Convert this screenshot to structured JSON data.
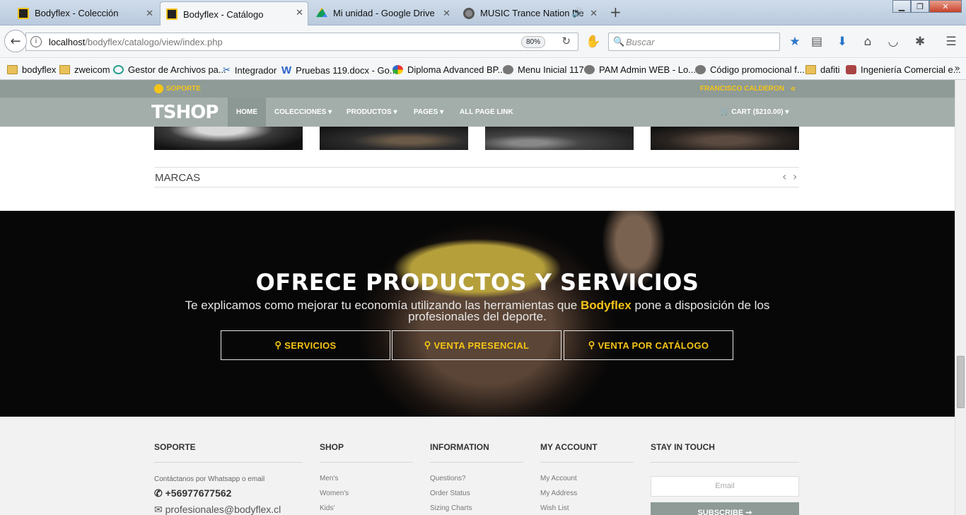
{
  "browser": {
    "tabs": [
      {
        "title": "Bodyflex - Colección",
        "icon": "bodyflex-favicon"
      },
      {
        "title": "Bodyflex - Catálogo",
        "icon": "bodyflex-favicon",
        "active": true
      },
      {
        "title": "Mi unidad - Google Drive",
        "icon": "google-drive-favicon"
      },
      {
        "title": "MUSIC Trance Nation Ne",
        "icon": "music-favicon"
      }
    ],
    "new_tab": "+",
    "url_host": "localhost",
    "url_path": "/bodyflex/catalogo/view/index.php",
    "zoom": "80%",
    "search_placeholder": "Buscar",
    "bookmarks": [
      {
        "label": "bodyflex",
        "icon": "folder"
      },
      {
        "label": "zweicom",
        "icon": "folder"
      },
      {
        "label": "Gestor de Archivos pa...",
        "icon": "circle"
      },
      {
        "label": "Integrador",
        "icon": "tool"
      },
      {
        "label": "Pruebas 119.docx - Go...",
        "icon": "w"
      },
      {
        "label": "Diploma Advanced BP...",
        "icon": "wheel"
      },
      {
        "label": "Menu Inicial 117",
        "icon": "globe"
      },
      {
        "label": "PAM Admin WEB - Lo...",
        "icon": "globe"
      },
      {
        "label": "Código promocional f...",
        "icon": "globe"
      },
      {
        "label": "dafiti",
        "icon": "folder"
      },
      {
        "label": "Ingeniería Comercial e...",
        "icon": "person"
      }
    ],
    "more": "»"
  },
  "site": {
    "topbar": {
      "support": "SOPORTE",
      "user": "FRANCISCO CALDERON",
      "toggle": "«"
    },
    "logo": "TSHOP",
    "nav": {
      "home": "HOME",
      "colecciones": "COLECCIONES",
      "productos": "PRODUCTOS",
      "pages": "PAGES",
      "all_page_link": "ALL PAGE LINK",
      "cart": "CART ($210.00)"
    },
    "marcas": {
      "title": "MARCAS",
      "prev": "‹",
      "next": "›"
    },
    "hero": {
      "title": "OFRECE PRODUCTOS Y SERVICIOS",
      "text_before": "Te explicamos como mejorar tu economía utilizando las herramientas que ",
      "brand": "Bodyflex",
      "text_after": " pone a disposición de los profesionales del deporte.",
      "buttons": [
        "SERVICIOS",
        "VENTA PRESENCIAL",
        "VENTA POR CATÁLOGO"
      ]
    },
    "footer": {
      "soporte": {
        "title": "SOPORTE",
        "note": "Contáctanos por Whatsapp o email",
        "phone": "+56977677562",
        "email": "profesionales@bodyflex.cl"
      },
      "shop": {
        "title": "SHOP",
        "items": [
          "Men's",
          "Women's",
          "Kids'"
        ]
      },
      "information": {
        "title": "INFORMATION",
        "items": [
          "Questions?",
          "Order Status",
          "Sizing Charts"
        ]
      },
      "account": {
        "title": "MY ACCOUNT",
        "items": [
          "My Account",
          "My Address",
          "Wish List"
        ]
      },
      "touch": {
        "title": "STAY IN TOUCH",
        "email_placeholder": "Email",
        "subscribe": "SUBSCRIBE ➞"
      }
    }
  },
  "colors": {
    "accent": "#f5c416",
    "nav_bg": "#a3aeaa",
    "topbar_bg": "#8e9b97",
    "hero_bg": "#070707",
    "footer_bg": "#f2f2f2"
  }
}
